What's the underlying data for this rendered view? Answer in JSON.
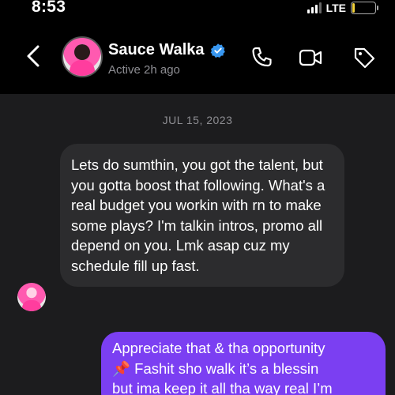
{
  "status_bar": {
    "time": "8:53",
    "network": "LTE",
    "battery": "10",
    "battery_level_percent": 10,
    "battery_color": "#f2d23c"
  },
  "header": {
    "contact_name": "Sauce Walka",
    "active_status": "Active 2h ago",
    "verified_color": "#3897f0",
    "icons": [
      "back-chevron-icon",
      "verified-badge-icon",
      "phone-icon",
      "video-camera-icon",
      "tag-icon"
    ]
  },
  "chat": {
    "date_label": "JUL 15, 2023",
    "incoming": {
      "text": "Lets do sumthin, you got the talent, but you gotta boost that following. What's a real budget you workin with rn to make some plays? I'm talkin intros, promo all depend on you. Lmk asap cuz my schedule fill up fast."
    },
    "outgoing": {
      "lines": [
        "Appreciate that & tha opportunity",
        "📌 Fashit sho walk it’s a blessin",
        "but ima keep it all tha way real I’m"
      ],
      "bubble_color": "#7b3ff2"
    }
  }
}
